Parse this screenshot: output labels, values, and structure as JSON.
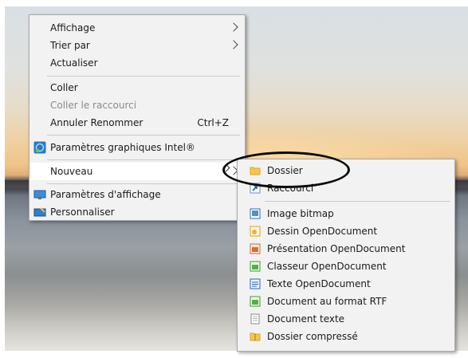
{
  "main_menu": {
    "items": [
      {
        "label": "Affichage",
        "has_submenu": true
      },
      {
        "label": "Trier par",
        "has_submenu": true
      },
      {
        "label": "Actualiser"
      },
      {
        "label": "Coller"
      },
      {
        "label": "Coller le raccourci",
        "disabled": true
      },
      {
        "label": "Annuler Renommer",
        "shortcut": "Ctrl+Z"
      },
      {
        "label": "Paramètres graphiques Intel®",
        "icon": "intel-graphics-icon"
      },
      {
        "label": "Nouveau",
        "has_submenu": true,
        "highlighted": true
      },
      {
        "label": "Paramètres d'affichage",
        "icon": "display-settings-icon"
      },
      {
        "label": "Personnaliser",
        "icon": "personalize-icon"
      }
    ]
  },
  "new_submenu": {
    "items": [
      {
        "label": "Dossier",
        "icon": "folder-icon"
      },
      {
        "label": "Raccourci",
        "icon": "shortcut-icon"
      },
      {
        "label": "Image bitmap",
        "icon": "bitmap-icon"
      },
      {
        "label": "Dessin OpenDocument",
        "icon": "od-drawing-icon"
      },
      {
        "label": "Présentation OpenDocument",
        "icon": "od-presentation-icon"
      },
      {
        "label": "Classeur OpenDocument",
        "icon": "od-spreadsheet-icon"
      },
      {
        "label": "Texte OpenDocument",
        "icon": "od-text-icon"
      },
      {
        "label": "Document au format RTF",
        "icon": "rtf-document-icon"
      },
      {
        "label": "Document texte",
        "icon": "text-document-icon"
      },
      {
        "label": "Dossier compressé",
        "icon": "zip-folder-icon"
      }
    ]
  },
  "colors": {
    "menu_bg": "#f2f2f2",
    "hover_bg": "#ffffff",
    "annotation": "#0a0a0a"
  }
}
